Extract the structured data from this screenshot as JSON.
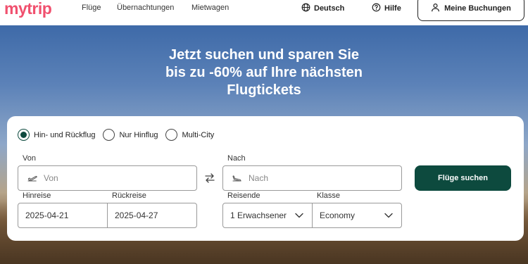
{
  "header": {
    "logo": "mytrip",
    "nav": [
      "Flüge",
      "Übernachtungen",
      "Mietwagen"
    ],
    "language": "Deutsch",
    "help": "Hilfe",
    "bookings": "Meine Buchungen"
  },
  "hero": {
    "title_lines": [
      "Jetzt suchen und sparen Sie",
      "bis zu -60% auf Ihre nächsten",
      "Flugtickets"
    ]
  },
  "search": {
    "trip_types": [
      {
        "label": "Hin- und Rückflug",
        "selected": true
      },
      {
        "label": "Nur Hinflug",
        "selected": false
      },
      {
        "label": "Multi-City",
        "selected": false
      }
    ],
    "from": {
      "label": "Von",
      "placeholder": "Von"
    },
    "to": {
      "label": "Nach",
      "placeholder": "Nach"
    },
    "depart": {
      "label": "Hinreise",
      "value": "2025-04-21"
    },
    "return": {
      "label": "Rückreise",
      "value": "2025-04-27"
    },
    "travelers": {
      "label": "Reisende",
      "value": "1 Erwachsener"
    },
    "class": {
      "label": "Klasse",
      "value": "Economy"
    },
    "submit": "Flüge suchen"
  },
  "colors": {
    "brand": "#f0506e",
    "accent": "#0d4a3e"
  }
}
